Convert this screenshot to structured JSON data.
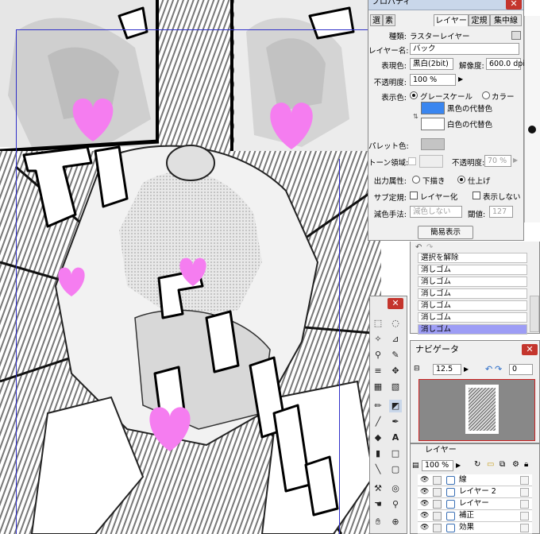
{
  "properties": {
    "title": "プロパティ",
    "tabs": [
      "選",
      "素",
      "レイヤー",
      "定規",
      "集中線"
    ],
    "type_label": "種類:",
    "type_value": "ラスターレイヤー",
    "name_label": "レイヤー名:",
    "name_value": "バック",
    "expr_color_label": "表現色:",
    "expr_color_value": "黒白(2bit)",
    "resolution_label": "解像度:",
    "resolution_value": "600.0 dpi",
    "opacity_label": "不透明度:",
    "opacity_value": "100 %",
    "display_color_label": "表示色:",
    "grayscale_label": "グレースケール",
    "color_label": "カラー",
    "black_sub_label": "黒色の代替色",
    "white_sub_label": "白色の代替色",
    "palette_color_label": "パレット色:",
    "tone_area_label": "トーン領域:",
    "tone_opacity_label": "不透明度:",
    "tone_opacity_value": "70 %",
    "output_attr_label": "出力属性:",
    "draft_label": "下描き",
    "finish_label": "仕上げ",
    "sub_ruler_label": "サブ定規:",
    "to_layer_label": "レイヤー化",
    "hide_label": "表示しない",
    "reduce_method_label": "減色手法:",
    "reduce_method_value": "減色しない",
    "threshold_label": "閾値:",
    "threshold_value": "127",
    "simple_button": "簡易表示"
  },
  "history": {
    "items": [
      "選択を解除",
      "消しゴム",
      "消しゴム",
      "消しゴム",
      "消しゴム",
      "消しゴム",
      "消しゴム"
    ],
    "selected_index": 6
  },
  "navigator": {
    "title": "ナビゲータ",
    "zoom_value": "12.5",
    "rotate_value": "0"
  },
  "layers": {
    "title": "レイヤー",
    "opacity_value": "100 %",
    "items": [
      "線",
      "レイヤー 2",
      "レイヤー",
      "補正",
      "効果"
    ]
  },
  "colors": {
    "accent_blue": "#3a86f0",
    "selected_row": "#9d9df5",
    "close_red": "#c4352d",
    "titlebar": "#c9d7ea",
    "censor_pink": "#f57df0"
  }
}
